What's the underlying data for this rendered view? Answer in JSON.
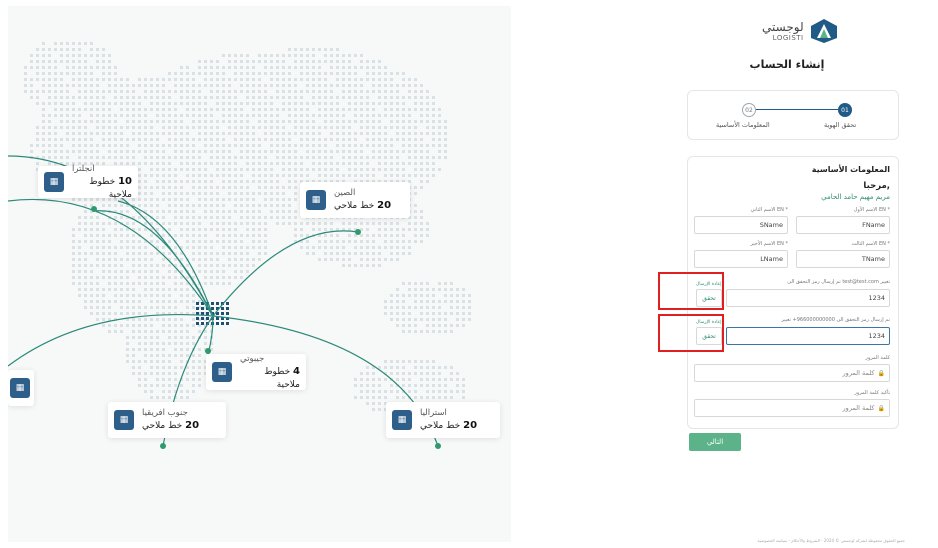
{
  "logo": {
    "ar": "لوجستي",
    "en": "LOGISTI"
  },
  "page_title": "إنشاء الحساب",
  "steps": [
    {
      "num": "01",
      "label": "تحقق الهوية",
      "active": true
    },
    {
      "num": "02",
      "label": "المعلومات الأساسية",
      "active": false
    }
  ],
  "form": {
    "section_title": "المعلومات الأساسية",
    "hello": "مرحبا,",
    "user_name": "مريم مهيم حامد الحامي",
    "first_name": {
      "label": "الاسم الأول EN *",
      "value": "FName"
    },
    "second_name": {
      "label": "الاسم الثاني EN *",
      "value": "SName"
    },
    "third_name": {
      "label": "الاسم الثالث EN *",
      "value": "TName"
    },
    "last_name": {
      "label": "الاسم الأخير EN *",
      "value": "LName"
    },
    "email_otp": {
      "label": "تم إرسال رمز التحقق الى test@test.com تغيير",
      "resend": "إعادة الإرسال",
      "value": "1234",
      "verify": "تحقق"
    },
    "phone_otp": {
      "label": "تم إرسال رمز التحقق الى 966000000000+ تغيير",
      "resend": "إعادة الإرسال",
      "value": "1234",
      "verify": "تحقق"
    },
    "password": {
      "label": "كلمة المرور",
      "placeholder": "كلمة المرور"
    },
    "confirm_password": {
      "label": "تأكيد كلمة المرور",
      "placeholder": "كلمة المرور"
    },
    "next": "التالي"
  },
  "footer": "جميع الحقوق محفوظة لشركة لوجستي © 2024 - الشروط والأحكام - سياسة الخصوصية",
  "map": {
    "cities": [
      {
        "key": "england",
        "name": "انجلترا",
        "count": "10",
        "unit": "خطوط ملاحية"
      },
      {
        "key": "china",
        "name": "الصين",
        "count": "20",
        "unit": "خط ملاحي"
      },
      {
        "key": "djibouti",
        "name": "جيبوتي",
        "count": "4",
        "unit": "خطوط ملاحية"
      },
      {
        "key": "south_africa",
        "name": "جنوب افريقيا",
        "count": "20",
        "unit": "خط ملاحي"
      },
      {
        "key": "australia",
        "name": "استراليا",
        "count": "20",
        "unit": "خط ملاحي"
      }
    ]
  },
  "colors": {
    "primary": "#1f5b86",
    "accent_green": "#2f8f6e",
    "button_green": "#5cb38a",
    "route": "#2c8a7a",
    "highlight": "#e02020"
  }
}
